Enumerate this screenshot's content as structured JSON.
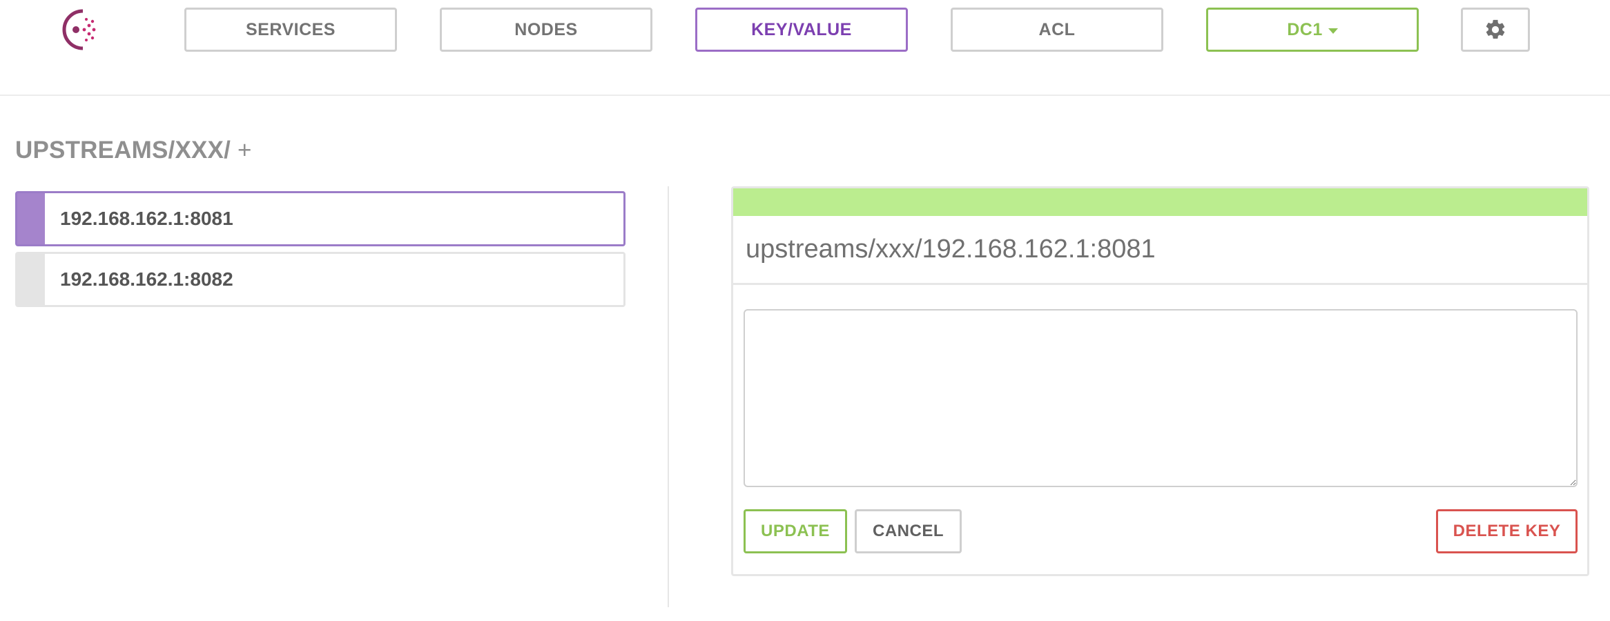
{
  "nav": {
    "items": [
      {
        "label": "SERVICES",
        "active": false
      },
      {
        "label": "NODES",
        "active": false
      },
      {
        "label": "KEY/VALUE",
        "active": true
      },
      {
        "label": "ACL",
        "active": false
      }
    ],
    "datacenter": {
      "label": "DC1",
      "icon": "caret-down-icon"
    },
    "settings_icon": "gear-icon"
  },
  "kv": {
    "breadcrumb": "UPSTREAMS/XXX/",
    "add_label": "+",
    "keys": [
      {
        "label": "192.168.162.1:8081",
        "selected": true
      },
      {
        "label": "192.168.162.1:8082",
        "selected": false
      }
    ]
  },
  "editor": {
    "title": "upstreams/xxx/192.168.162.1:8081",
    "value": "",
    "buttons": {
      "update": "UPDATE",
      "cancel": "CANCEL",
      "delete": "DELETE KEY"
    }
  },
  "colors": {
    "accent_purple": "#9b6dc6",
    "accent_green": "#8cc152",
    "status_green": "#bbed8f",
    "danger_red": "#d9534f"
  }
}
